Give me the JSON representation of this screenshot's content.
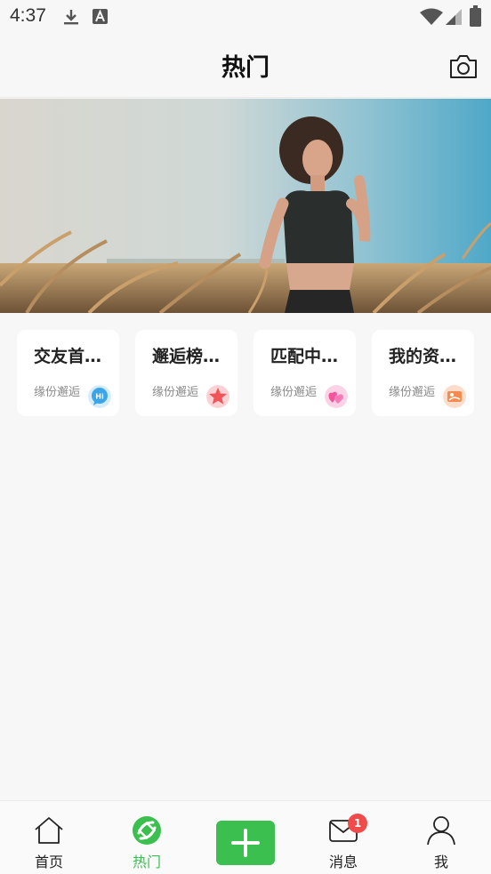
{
  "status_bar": {
    "time": "4:37",
    "icons": [
      "download-icon",
      "font-a-icon",
      "wifi-icon",
      "signal-icon",
      "battery-icon"
    ]
  },
  "header": {
    "title": "热门",
    "camera_icon": "camera-icon"
  },
  "banner": {
    "image": "photo of a woman in a wheat field under blue sky"
  },
  "cards": [
    {
      "title": "交友首…",
      "subtitle": "缘份邂逅",
      "icon": "hi-chat-icon",
      "color": "#3aa5e8"
    },
    {
      "title": "邂逅榜…",
      "subtitle": "缘份邂逅",
      "icon": "star-icon",
      "color": "#f0555a"
    },
    {
      "title": "匹配中…",
      "subtitle": "缘份邂逅",
      "icon": "hearts-icon",
      "color": "#f2559b"
    },
    {
      "title": "我的资…",
      "subtitle": "缘份邂逅",
      "icon": "profile-card-icon",
      "color": "#f58b4e"
    }
  ],
  "tabbar": {
    "tabs": [
      {
        "label": "首页",
        "icon": "home-icon",
        "active": false
      },
      {
        "label": "热门",
        "icon": "hot-icon",
        "active": true
      },
      {
        "label": "",
        "icon": "plus-icon",
        "active": false
      },
      {
        "label": "消息",
        "icon": "mail-icon",
        "active": false,
        "badge": "1"
      },
      {
        "label": "我",
        "icon": "person-icon",
        "active": false
      }
    ],
    "active_color": "#3bbf4f"
  }
}
